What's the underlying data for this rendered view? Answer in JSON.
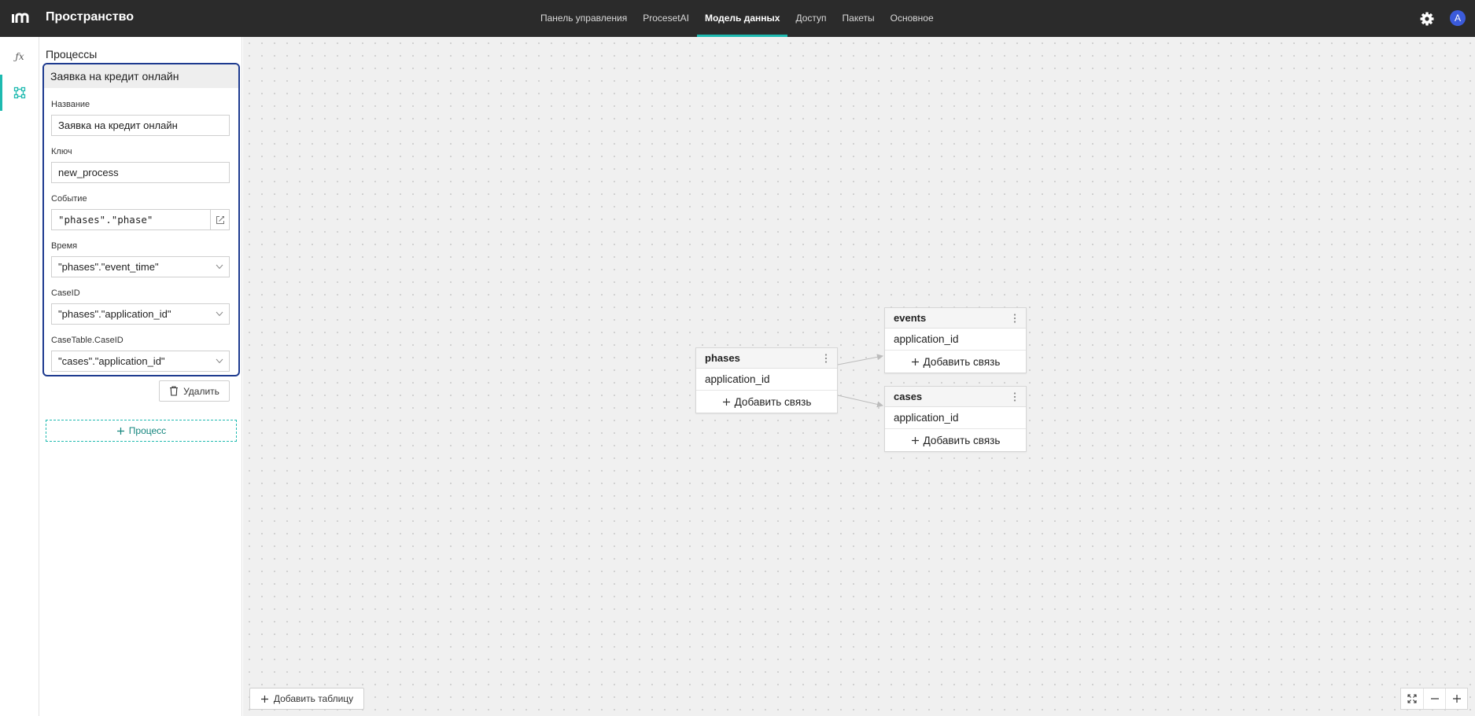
{
  "app": {
    "title": "Пространство"
  },
  "nav": {
    "items": [
      {
        "label": "Панель управления"
      },
      {
        "label": "ProcesetAI"
      },
      {
        "label": "Модель данных",
        "active": true
      },
      {
        "label": "Доступ"
      },
      {
        "label": "Пакеты"
      },
      {
        "label": "Основное"
      }
    ]
  },
  "user": {
    "initial": "A"
  },
  "colors": {
    "accent": "#1ebab0",
    "selection": "#1d3a8f",
    "avatar": "#3b5bdb",
    "topbar": "#2b2b2b"
  },
  "icons": {
    "rail": [
      "fx-icon",
      "data-model-icon"
    ]
  },
  "panel": {
    "title": "Процессы",
    "process": {
      "header": "Заявка на кредит онлайн",
      "name_label": "Название",
      "name_value": "Заявка на кредит онлайн",
      "key_label": "Ключ",
      "key_value": "new_process",
      "event_label": "Событие",
      "event_value": "\"phases\".\"phase\"",
      "time_label": "Время",
      "time_value": "\"phases\".\"event_time\"",
      "caseid_label": "CaseID",
      "caseid_value": "\"phases\".\"application_id\"",
      "casetable_label": "CaseTable.CaseID",
      "casetable_value": "\"cases\".\"application_id\""
    },
    "delete_label": "Удалить",
    "add_process_label": "Процесс"
  },
  "canvas": {
    "tables": {
      "phases": {
        "name": "phases",
        "fields": [
          "application_id"
        ],
        "add_link": "Добавить связь"
      },
      "events": {
        "name": "events",
        "fields": [
          "application_id"
        ],
        "add_link": "Добавить связь"
      },
      "cases": {
        "name": "cases",
        "fields": [
          "application_id"
        ],
        "add_link": "Добавить связь"
      }
    },
    "relations": [
      {
        "from": "phases",
        "to": "events"
      },
      {
        "from": "phases",
        "to": "cases"
      }
    ],
    "add_table_label": "Добавить таблицу"
  }
}
